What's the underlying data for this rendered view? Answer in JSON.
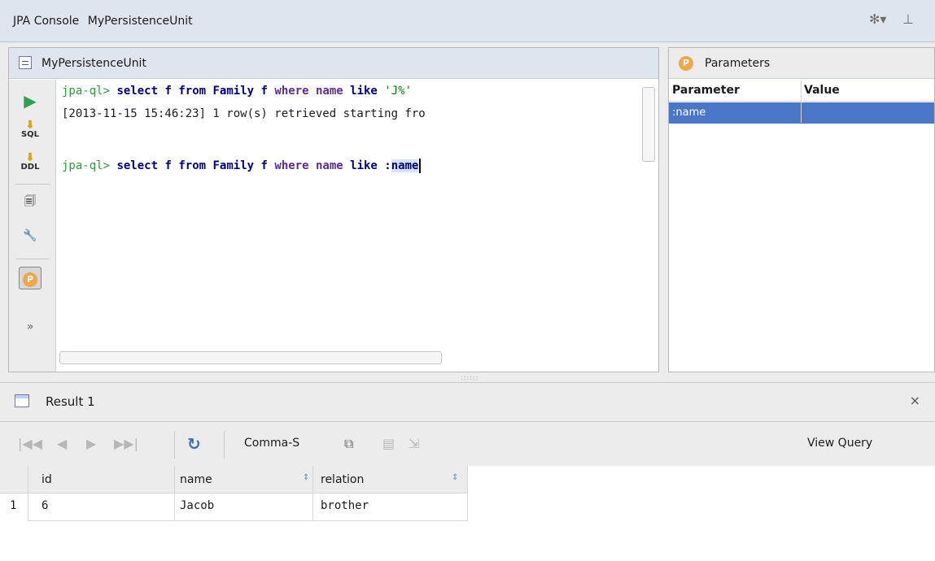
{
  "titlebar": {
    "title": "JPA Console",
    "subtitle": "MyPersistenceUnit",
    "icons": [
      "gear-dropdown-icon",
      "pin-icon"
    ]
  },
  "console": {
    "header": "MyPersistenceUnit",
    "toolbar": [
      "run-icon",
      "sql-icon",
      "ddl-icon",
      "history-icon",
      "settings-icon",
      "parameters-icon",
      "more-icon"
    ],
    "more_label": "»",
    "lines": [
      {
        "prompt": "jpa-ql>",
        "select": "select",
        "f1": "f",
        "from": "from",
        "family": "Family",
        "f2": "f",
        "where": "where",
        "name": "name",
        "like": "like",
        "value": "'J%'"
      },
      {
        "log": "[2013-11-15 15:46:23] 1 row(s) retrieved starting fro"
      },
      {
        "prompt": "jpa-ql>",
        "select": "select",
        "f1": "f",
        "from": "from",
        "family": "Family",
        "f2": "f",
        "where": "where",
        "name": "name",
        "like": "like",
        "param_prefix": ":",
        "param": "name"
      }
    ]
  },
  "parameters": {
    "header": "Parameters",
    "icon_label": "P",
    "columns": [
      "Parameter",
      "Value"
    ],
    "rows": [
      {
        "parameter": ":name",
        "value": ""
      }
    ]
  },
  "splitter_grip": "::::::",
  "results": {
    "tab_title": "Result 1",
    "close_label": "×",
    "export_label": "Comma-S",
    "view_query_label": "View Query",
    "nav_icons": [
      "first-page-icon",
      "previous-page-icon",
      "next-page-icon",
      "last-page-icon",
      "refresh-icon",
      "copy-icon",
      "save-icon",
      "export-icon"
    ],
    "columns": [
      "id",
      "name",
      "relation"
    ],
    "rows": [
      {
        "num": "1",
        "id": "6",
        "name": "Jacob",
        "relation": "brother"
      }
    ]
  },
  "colors": {
    "accent": "#4a76c7",
    "prompt": "#2b9a38",
    "keyword": "#000080",
    "identifier": "#5d2d92",
    "string": "#008000"
  }
}
